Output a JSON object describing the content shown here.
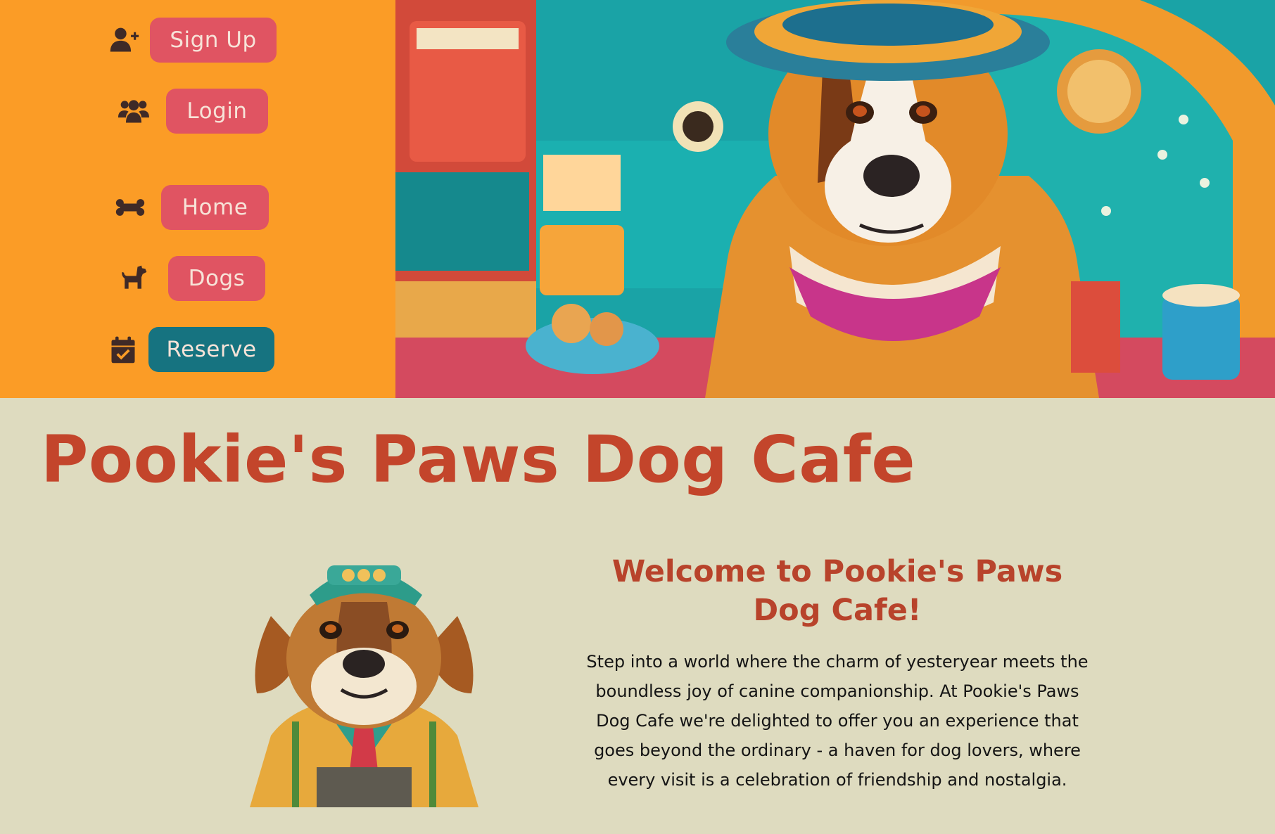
{
  "nav": {
    "items": [
      {
        "label": "Sign Up",
        "icon": "user-plus-icon",
        "style": "pink"
      },
      {
        "label": "Login",
        "icon": "users-icon",
        "style": "pink"
      },
      {
        "label": "Home",
        "icon": "bone-icon",
        "style": "pink"
      },
      {
        "label": "Dogs",
        "icon": "dog-icon",
        "style": "pink"
      },
      {
        "label": "Reserve",
        "icon": "calendar-check-icon",
        "style": "teal"
      }
    ]
  },
  "colors": {
    "nav_bg": "#fb9c26",
    "button_pink": "#e05462",
    "button_teal": "#167380",
    "title": "#c3452b",
    "page_bg": "#dedbbf"
  },
  "main": {
    "title": "Pookie's Paws Dog Cafe",
    "welcome_heading": "Welcome to Pookie's Paws Dog Cafe!",
    "intro": "Step into a world where the charm of yesteryear meets the boundless joy of canine companionship. At Pookie's Paws Dog Cafe we're delighted to offer you an experience that goes beyond the ordinary - a haven for dog lovers, where every visit is a celebration of friendship and nostalgia."
  }
}
